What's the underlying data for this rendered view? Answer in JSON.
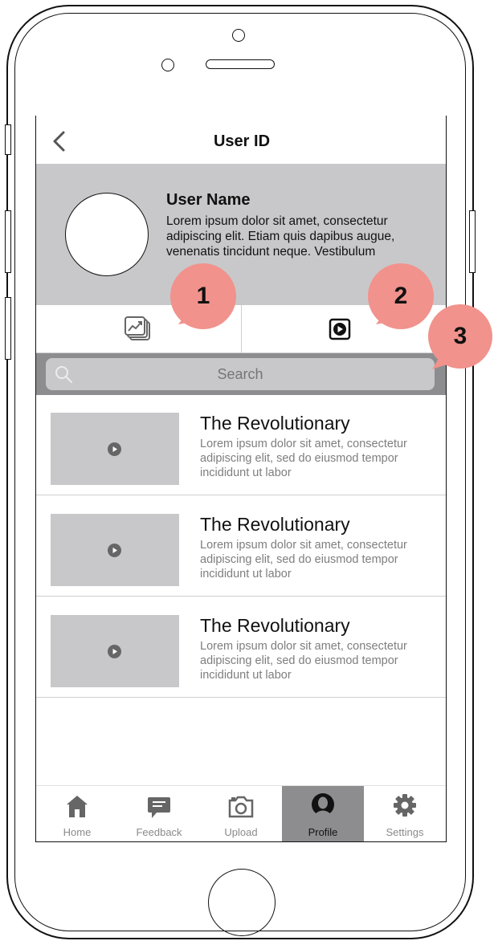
{
  "header": {
    "title": "User ID"
  },
  "profile": {
    "user_name": "User Name",
    "bio": "Lorem ipsum dolor sit amet, consectetur adipiscing elit. Etiam quis dapibus augue, venenatis tincidunt neque. Vestibulum"
  },
  "profile_tabs": [
    {
      "icon": "image-gallery-chart-icon"
    },
    {
      "icon": "video-play-icon"
    }
  ],
  "search": {
    "placeholder": "Search",
    "icon": "search-icon"
  },
  "videos": [
    {
      "title": "The Revolutionary",
      "description": "Lorem ipsum dolor sit amet, consectetur adipiscing elit, sed do eiusmod tempor incididunt ut labor"
    },
    {
      "title": "The Revolutionary",
      "description": "Lorem ipsum dolor sit amet, consectetur adipiscing elit, sed do eiusmod tempor incididunt ut labor"
    },
    {
      "title": "The Revolutionary",
      "description": "Lorem ipsum dolor sit amet, consectetur adipiscing elit, sed do eiusmod tempor incididunt ut labor"
    }
  ],
  "tabbar": {
    "items": [
      {
        "label": "Home",
        "icon": "home-icon",
        "active": false
      },
      {
        "label": "Feedback",
        "icon": "feedback-icon",
        "active": false
      },
      {
        "label": "Upload",
        "icon": "camera-icon",
        "active": false
      },
      {
        "label": "Profile",
        "icon": "profile-icon",
        "active": true
      },
      {
        "label": "Settings",
        "icon": "gear-icon",
        "active": false
      }
    ]
  },
  "annotations": [
    "1",
    "2",
    "3"
  ],
  "colors": {
    "panel_gray": "#c8c8cb",
    "search_bar_gray": "#8d8d90",
    "active_tab_gray": "#8d8d90",
    "callout": "#f1928c"
  }
}
